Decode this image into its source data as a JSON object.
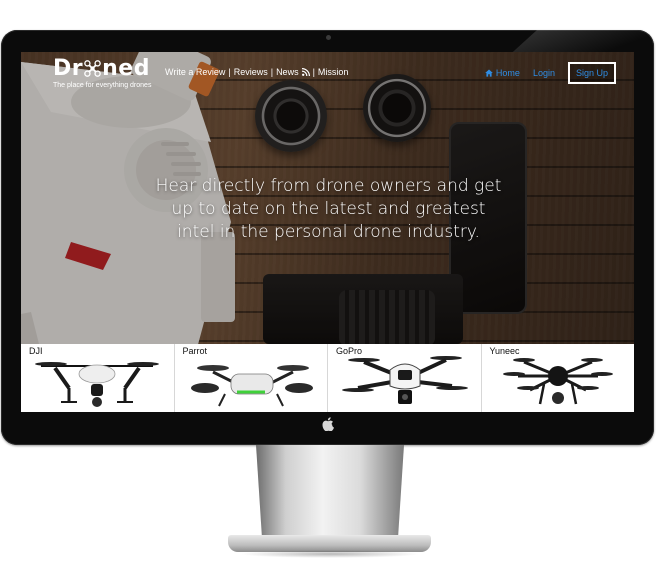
{
  "site": {
    "brand_prefix": "Dr",
    "brand_suffix": "ned",
    "brand_icon": "drone-icon",
    "tagline": "The place for everything drones"
  },
  "nav": {
    "links": [
      "Write a Review",
      "Reviews",
      "News",
      "Mission"
    ],
    "separator": "|",
    "news_icon": "rss-icon",
    "home_icon": "home-icon",
    "home": "Home",
    "login": "Login",
    "signup": "Sign Up"
  },
  "hero": {
    "headline": "Hear directly from drone owners and get up to date on the latest and greatest intel in the personal drone industry."
  },
  "brands": [
    {
      "label": "DJI"
    },
    {
      "label": "Parrot"
    },
    {
      "label": "GoPro"
    },
    {
      "label": "Yuneec"
    }
  ],
  "colors": {
    "link_blue": "#2f8de4",
    "text_white": "#ffffff",
    "bezel": "#0b0b0b"
  }
}
